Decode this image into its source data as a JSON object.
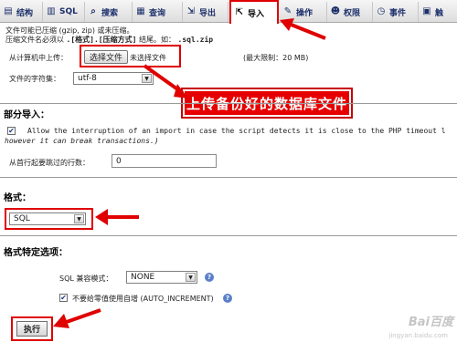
{
  "tabs": [
    {
      "label": "结构",
      "icon": "structure-icon",
      "glyph": "▤"
    },
    {
      "label": "SQL",
      "icon": "sql-icon",
      "glyph": "▥"
    },
    {
      "label": "搜索",
      "icon": "search-icon",
      "glyph": "⌕"
    },
    {
      "label": "查询",
      "icon": "query-icon",
      "glyph": "▦"
    },
    {
      "label": "导出",
      "icon": "export-icon",
      "glyph": "⇲"
    },
    {
      "label": "导入",
      "icon": "import-icon",
      "glyph": "⇱"
    },
    {
      "label": "操作",
      "icon": "wrench-icon",
      "glyph": "✎"
    },
    {
      "label": "权限",
      "icon": "privileges-icon",
      "glyph": "☻"
    },
    {
      "label": "事件",
      "icon": "event-icon",
      "glyph": "◷"
    },
    {
      "label": "触",
      "icon": "trigger-icon",
      "glyph": "▣"
    }
  ],
  "file_section": {
    "compress_note": "文件可能已压缩 (gzip, zip) 或未压缩。",
    "name_rule_prefix": "压缩文件名必须以",
    "name_rule_format": ".[格式].[压缩方式]",
    "name_rule_suffix": "结尾。如：",
    "name_rule_example": ".sql.zip",
    "upload_label": "从计算机中上传：",
    "choose_button": "选择文件",
    "no_file": "未选择文件",
    "max_limit": "(最大限制：20 MB)",
    "charset_label": "文件的字符集：",
    "charset_value": "utf-8"
  },
  "callout": "上传备份好的数据库文件",
  "partial_import": {
    "title": "部分导入：",
    "allow_line1": "Allow the interruption of an import in case the script detects it is close to the PHP timeout l",
    "allow_line2": "however it can break transactions.)",
    "allow_checked": true,
    "skip_label": "从首行起要跳过的行数：",
    "skip_value": "0"
  },
  "format": {
    "title": "格式：",
    "value": "SQL"
  },
  "format_options": {
    "title": "格式特定选项：",
    "compat_label": "SQL 兼容模式：",
    "compat_value": "NONE",
    "auto_inc_label": "不要给零值使用自增 (AUTO_INCREMENT)",
    "auto_inc_checked": true
  },
  "execute_button": "执行",
  "watermark": "Bai百度",
  "watermark_sub": "jingyan.baidu.com",
  "colors": {
    "annotation_red": "#e00000",
    "tab_text": "#1c2f6b",
    "help_blue": "#5a7fc8"
  }
}
